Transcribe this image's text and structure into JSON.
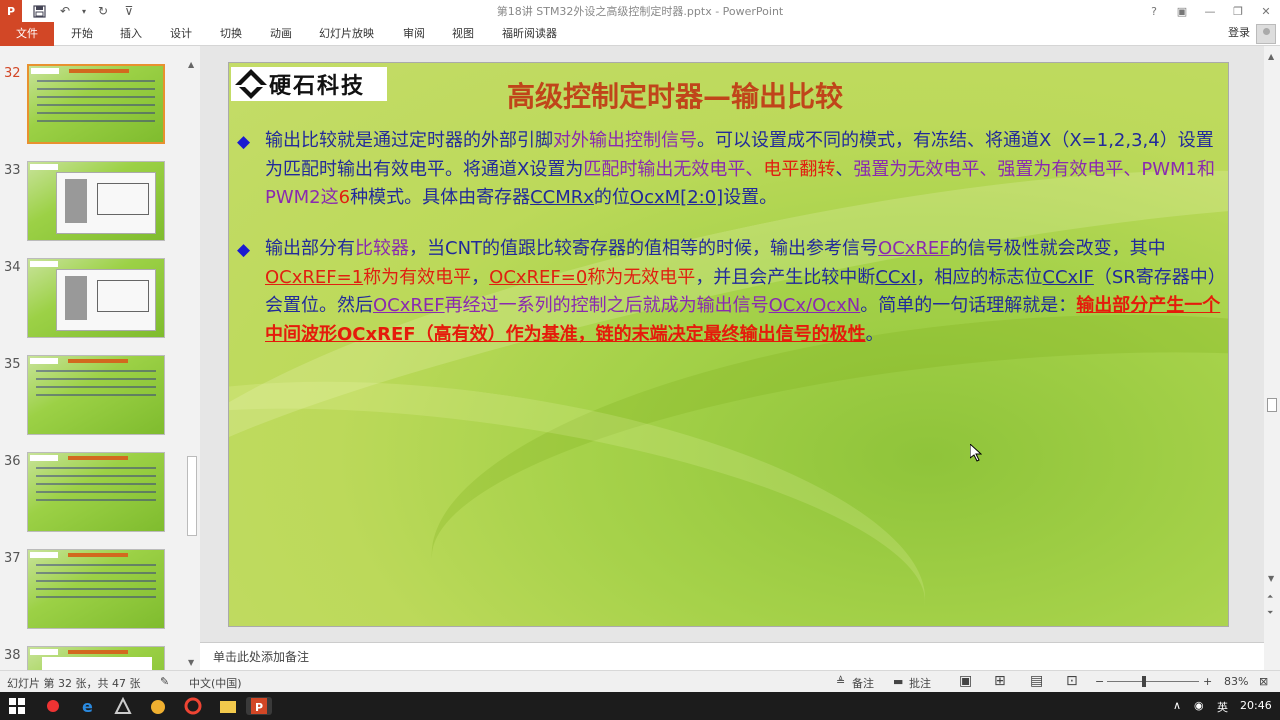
{
  "window": {
    "title": "第18讲 STM32外设之高级控制定时器.pptx - PowerPoint",
    "controls": [
      "?",
      "▣",
      "—",
      "❐",
      "✕"
    ]
  },
  "qat": {
    "app_icon": "P",
    "save_icon": "save-icon",
    "undo_icon": "undo-icon",
    "redo_icon": "redo-icon"
  },
  "ribbon": {
    "file": "文件",
    "tabs": [
      "开始",
      "插入",
      "设计",
      "切换",
      "动画",
      "幻灯片放映",
      "审阅",
      "视图",
      "福昕阅读器"
    ],
    "login": "登录"
  },
  "thumbnails": [
    {
      "num": "32",
      "active": true
    },
    {
      "num": "33",
      "active": false
    },
    {
      "num": "34",
      "active": false
    },
    {
      "num": "35",
      "active": false
    },
    {
      "num": "36",
      "active": false
    },
    {
      "num": "37",
      "active": false
    },
    {
      "num": "38",
      "active": false
    }
  ],
  "slide": {
    "logo_text": "硬石科技",
    "title": "高级控制定时器—输出比较",
    "bullet1": [
      {
        "t": "输出比较就是通过定时器的外部引脚",
        "c": ""
      },
      {
        "t": "对外输出控制信号",
        "c": "light"
      },
      {
        "t": "。可以设置成不同的模式，有冻结、将通道X（X=1,2,3,4）设置为匹配时输出有效电平。将通道X设置为",
        "c": ""
      },
      {
        "t": "匹配时输出无效电平、",
        "c": "light"
      },
      {
        "t": "电平翻转",
        "c": "red"
      },
      {
        "t": "、",
        "c": ""
      },
      {
        "t": "强置为无效电平、强置为有效电平、PWM1和PWM2这",
        "c": "light"
      },
      {
        "t": "6",
        "c": "red"
      },
      {
        "t": "种模式。具体由寄存器",
        "c": ""
      },
      {
        "t": "CCMRx",
        "c": "ul"
      },
      {
        "t": "的位",
        "c": ""
      },
      {
        "t": "OcxM[2:0]",
        "c": "ul"
      },
      {
        "t": "设置。",
        "c": ""
      }
    ],
    "bullet2": [
      {
        "t": "输出部分有",
        "c": ""
      },
      {
        "t": "比较器",
        "c": "light"
      },
      {
        "t": "，当CNT的值跟比较寄存器的值相等的时候，输出参考信号",
        "c": ""
      },
      {
        "t": "OCxREF",
        "c": "light ul"
      },
      {
        "t": "的信号极性就会改变，其中",
        "c": ""
      },
      {
        "t": "OCxREF=1",
        "c": "red ul"
      },
      {
        "t": "称为有效电平",
        "c": "red"
      },
      {
        "t": "，",
        "c": ""
      },
      {
        "t": "OCxREF=0",
        "c": "red ul"
      },
      {
        "t": "称为无效电平",
        "c": "red"
      },
      {
        "t": "，并且会产生比较中断",
        "c": ""
      },
      {
        "t": "CCxI",
        "c": "ul"
      },
      {
        "t": "，相应的标志位",
        "c": ""
      },
      {
        "t": "CCxIF",
        "c": "ul"
      },
      {
        "t": "（SR寄存器中）会置位。然后",
        "c": ""
      },
      {
        "t": "OCxREF",
        "c": "light ul"
      },
      {
        "t": "再经过一系列的控制之后就成为输出信号",
        "c": "light"
      },
      {
        "t": "OCx/OcxN",
        "c": "light ul"
      },
      {
        "t": "。简单的一句话理解就是：",
        "c": ""
      },
      {
        "t": "输出部分产生一个中间波形OCxREF（高有效）作为基准，链的末端决定最终输出信号的极性",
        "c": "redbold"
      },
      {
        "t": "。",
        "c": ""
      }
    ]
  },
  "notes": {
    "placeholder": "单击此处添加备注"
  },
  "status": {
    "slide_info": "幻灯片 第 32 张，共 47 张",
    "language": "中文(中国)",
    "notes_btn": "备注",
    "comments_btn": "批注",
    "zoom": "83%"
  },
  "taskbar": {
    "ime": "英",
    "time": "20:46"
  },
  "colors": {
    "accent": "#d24726",
    "title": "#c0451a",
    "body": "#222a9a"
  }
}
